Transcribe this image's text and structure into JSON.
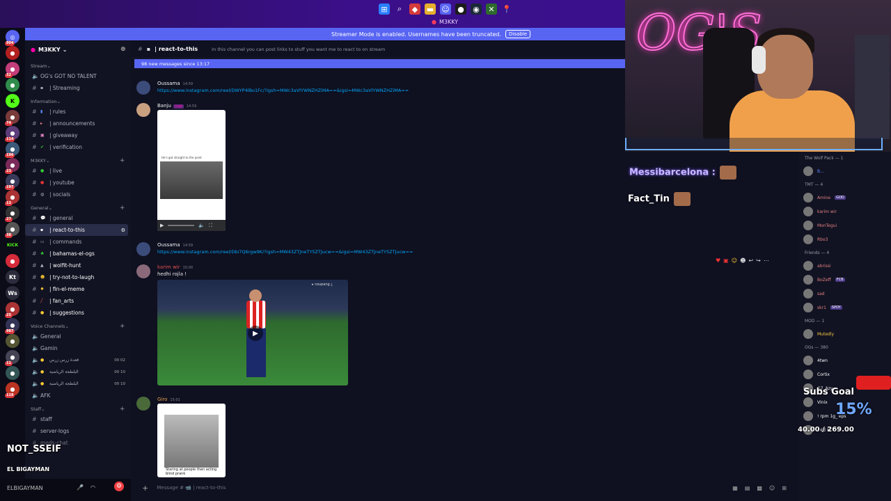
{
  "window_title": "M3KKY",
  "banner": {
    "text": "Streamer Mode is enabled. Usernames have been truncated.",
    "disable": "Disable"
  },
  "server": {
    "name": "M3KKY"
  },
  "categories": [
    {
      "name": "Stream",
      "channels": [
        {
          "label": "OG's GOT NO TALENT",
          "icon": "speaker"
        },
        {
          "label": "| Streaming",
          "icon": "hash"
        }
      ]
    },
    {
      "name": "Information",
      "channels": [
        {
          "label": "| rules"
        },
        {
          "label": "| announcements"
        },
        {
          "label": "| giveaway"
        },
        {
          "label": "| verification"
        }
      ]
    },
    {
      "name": "M3KKY",
      "channels": [
        {
          "label": "| live"
        },
        {
          "label": "| youtube"
        },
        {
          "label": "| socials"
        }
      ]
    },
    {
      "name": "General",
      "channels": [
        {
          "label": "| general"
        },
        {
          "label": "| react-to-this"
        },
        {
          "label": "| commands"
        },
        {
          "label": "| bahamas-el-ogs"
        },
        {
          "label": "| wolfit-hunt"
        },
        {
          "label": "| try-not-to-laugh"
        },
        {
          "label": "| fin-el-meme"
        },
        {
          "label": "| fan_arts"
        },
        {
          "label": "| suggestions"
        }
      ]
    },
    {
      "name": "Voice Channels",
      "channels": [
        {
          "label": "General"
        },
        {
          "label": "Gamin"
        },
        {
          "label": "قعدة زرس زرس",
          "count": "00 02"
        },
        {
          "label": "البلطجة الرياضية",
          "count": "00 10"
        },
        {
          "label": "البلطجة الرياضية",
          "count": "00 10"
        },
        {
          "label": "AFK"
        }
      ]
    },
    {
      "name": "Staff",
      "channels": [
        {
          "label": "staff"
        },
        {
          "label": "server-logs"
        },
        {
          "label": "mods-chat"
        }
      ]
    }
  ],
  "chat": {
    "channel": "| react-to-this",
    "topic": "In this channel you can post links to stuff you want me to react to on stream",
    "new_messages": "98 new messages since 13:17",
    "input_placeholder": "Message # 📹 | react-to-this"
  },
  "messages": [
    {
      "author": "Oussama",
      "time": "14:59",
      "link": "https://www.instagram.com/reel/DWYP4lBo1Fc/?igsh=MWc3aVlYWNZHZiMA==&igsi=MWc3aVlYWNZHZiMA=="
    },
    {
      "author": "Banju",
      "tag": "mgk",
      "time": "14:59",
      "caption": "He's got straight to the point"
    },
    {
      "author": "Oussama",
      "time": "14:59",
      "link": "https://www.instagram.com/reel/Dbi7Q6rgw9K/?igsh=MW43ZTJneTY5ZTJucw==&igsi=MW43ZTJneTY5ZTJucw=="
    },
    {
      "author": "karim wir",
      "time": "15:00",
      "text": "hedhi rojla !",
      "video_watermark": "coupang"
    },
    {
      "author": "Giro",
      "time": "15:01",
      "caption": "Staring at people then acting blind prank"
    }
  ],
  "overlay": {
    "name": "NOT_SSEIF",
    "subline": "EL BIGAYMAN",
    "user": "ELBIGAYMAN",
    "chat_lines": [
      "Messibarcelona :",
      "Fact_Tin"
    ]
  },
  "members": [
    {
      "group": "The Wolf Pack — 1",
      "users": [
        {
          "name": "B..."
        }
      ]
    },
    {
      "group": "TMT — 4",
      "users": [
        {
          "name": "Amine",
          "badge": "GOD"
        },
        {
          "name": "karim wir"
        },
        {
          "name": "MonTegui"
        },
        {
          "name": "Rbo3"
        }
      ]
    },
    {
      "group": "Friends — 4",
      "users": [
        {
          "name": "abrissi"
        },
        {
          "name": "BoZeff",
          "badge": "FCB"
        },
        {
          "name": "sad"
        },
        {
          "name": "skr1",
          "badge": "SPDY"
        }
      ]
    },
    {
      "group": "MOD — 1",
      "users": [
        {
          "name": "Mutedly"
        }
      ]
    },
    {
      "group": "OGs — 380",
      "users": [
        {
          "name": "4twn"
        },
        {
          "name": "Cortix"
        },
        {
          "name": "G7_Azy"
        },
        {
          "name": "Vinix"
        },
        {
          "name": "! rpm 1g_ eps"
        },
        {
          "name": "! €d ¥"
        }
      ]
    }
  ],
  "subs_goal": {
    "label": "Subs Goal",
    "percent": "15%",
    "amount": "40.00 / 269.00"
  }
}
